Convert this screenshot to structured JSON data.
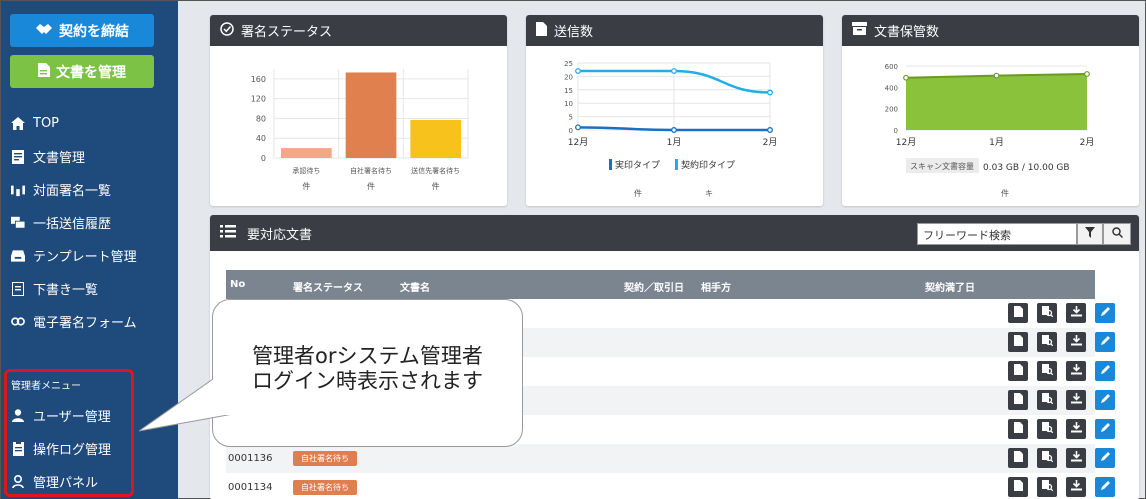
{
  "sidebar": {
    "primary_button": "契約を締結",
    "secondary_button": "文書を管理",
    "items": [
      {
        "label": "TOP",
        "icon": "home-icon"
      },
      {
        "label": "文書管理",
        "icon": "document-icon"
      },
      {
        "label": "対面署名一覧",
        "icon": "face-to-face-icon"
      },
      {
        "label": "一括送信履歴",
        "icon": "bulk-send-icon"
      },
      {
        "label": "テンプレート管理",
        "icon": "template-icon"
      },
      {
        "label": "下書き一覧",
        "icon": "draft-icon"
      },
      {
        "label": "電子署名フォーム",
        "icon": "link-icon"
      }
    ],
    "admin_title": "管理者メニュー",
    "admin_items": [
      {
        "label": "ユーザー管理",
        "icon": "user-icon"
      },
      {
        "label": "操作ログ管理",
        "icon": "log-icon"
      },
      {
        "label": "管理パネル",
        "icon": "panel-icon"
      }
    ]
  },
  "cards": {
    "signature_status": {
      "title": "署名ステータス",
      "unit": "件"
    },
    "sent_count": {
      "title": "送信数",
      "unit_left": "件",
      "unit_right": "キ"
    },
    "storage": {
      "title": "文書保管数",
      "scan_label": "スキャン文書容量",
      "scan_value": "0.03 GB / 10.00 GB",
      "unit": "件"
    }
  },
  "chart_data": [
    {
      "type": "bar",
      "categories": [
        "承認待ち",
        "自社署名待ち",
        "送信先署名待ち"
      ],
      "values": [
        20,
        173,
        77
      ],
      "ylim": [
        0,
        180
      ],
      "yticks": [
        0,
        40,
        80,
        120,
        160
      ],
      "colors": [
        "#f5a58a",
        "#e0804f",
        "#f7c21c"
      ],
      "grid": true
    },
    {
      "type": "line",
      "x": [
        "12月",
        "1月",
        "2月"
      ],
      "ylim": [
        0,
        25
      ],
      "yticks": [
        0,
        5,
        10,
        15,
        20,
        25
      ],
      "series": [
        {
          "name": "実印タイプ",
          "values": [
            1,
            0,
            0
          ],
          "color": "#1a70c0"
        },
        {
          "name": "契約印タイプ",
          "values": [
            22,
            22,
            14
          ],
          "color": "#22aee4"
        }
      ],
      "legend": "bottom",
      "grid": true
    },
    {
      "type": "area",
      "x": [
        "12月",
        "1月",
        "2月"
      ],
      "ylim": [
        0,
        600
      ],
      "yticks": [
        0,
        200,
        400,
        600
      ],
      "values": [
        490,
        510,
        525
      ],
      "color": "#8ac23c",
      "grid": true
    }
  ],
  "table": {
    "title": "要対応文書",
    "search_placeholder": "フリーワード検索",
    "columns": [
      "No",
      "署名ステータス",
      "文書名",
      "契約／取引日",
      "相手方",
      "契約満了日"
    ],
    "rows": [
      {
        "no": "",
        "status": ""
      },
      {
        "no": "",
        "status": ""
      },
      {
        "no": "",
        "status": ""
      },
      {
        "no": "",
        "status": ""
      },
      {
        "no": "",
        "status": ""
      },
      {
        "no": "0001136",
        "status": "自社署名待ち"
      },
      {
        "no": "0001134",
        "status": "自社署名待ち"
      }
    ]
  },
  "callout": {
    "line1": "管理者orシステム管理者",
    "line2": "ログイン時表示されます"
  }
}
